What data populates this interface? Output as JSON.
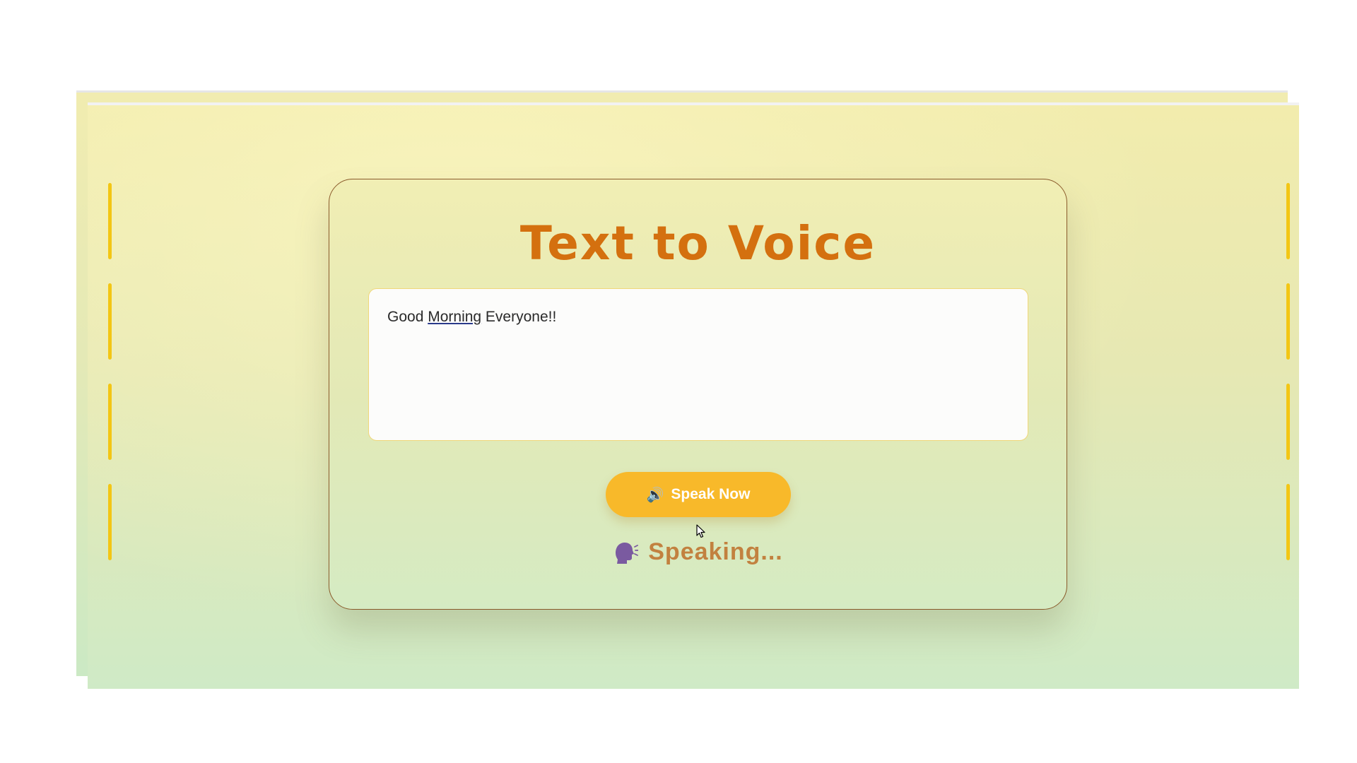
{
  "app": {
    "title": "Text to Voice"
  },
  "input": {
    "text_before": "Good ",
    "text_misspelled": "Morning",
    "text_after": " Everyone!!"
  },
  "button": {
    "icon": "speaker-icon",
    "icon_glyph": "🔊",
    "label": "Speak Now"
  },
  "status": {
    "icon": "speaking-head-icon",
    "text": "Speaking..."
  },
  "colors": {
    "title": "#d4700f",
    "button": "#f8b92a",
    "status": "#c2813f",
    "dash_accent": "#f3c614"
  }
}
